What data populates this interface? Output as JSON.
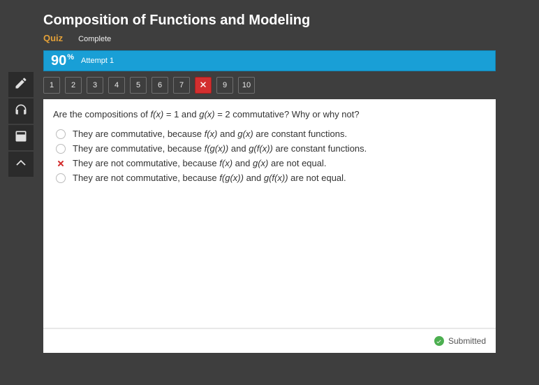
{
  "header": {
    "title": "Composition of Functions and Modeling",
    "quiz_label": "Quiz",
    "complete_label": "Complete"
  },
  "score": {
    "percent": "90",
    "unit": "%",
    "attempt_label": "Attempt 1"
  },
  "qnav": {
    "items": [
      "1",
      "2",
      "3",
      "4",
      "5",
      "6",
      "7",
      "",
      "9",
      "10"
    ],
    "wrong_index": 7
  },
  "question": {
    "prompt_pre": "Are the compositions of ",
    "fx": "f(x)",
    "eq1": " = 1 and ",
    "gx": "g(x)",
    "eq2": " = 2 commutative? Why or why not?"
  },
  "answers": [
    {
      "marker": "circle",
      "segments": [
        "They are commutative, because ",
        {
          "fn": "f(x)"
        },
        " and ",
        {
          "fn": "g(x)"
        },
        " are constant functions."
      ]
    },
    {
      "marker": "circle",
      "segments": [
        "They are commutative, because ",
        {
          "fn": "f(g(x))"
        },
        " and ",
        {
          "fn": "g(f(x))"
        },
        " are constant functions."
      ]
    },
    {
      "marker": "xmark",
      "segments": [
        " They are not commutative, because ",
        {
          "fn": "f(x)"
        },
        " and ",
        {
          "fn": "g(x)"
        },
        " are not equal."
      ]
    },
    {
      "marker": "circle",
      "segments": [
        "They are not commutative, because ",
        {
          "fn": "f(g(x))"
        },
        " and ",
        {
          "fn": "g(f(x))"
        },
        " are not equal."
      ]
    }
  ],
  "footer": {
    "submitted_label": "Submitted"
  },
  "sidebar": {
    "icons": [
      "pencil-icon",
      "headphones-icon",
      "calculator-icon",
      "chevron-up-icon"
    ]
  }
}
